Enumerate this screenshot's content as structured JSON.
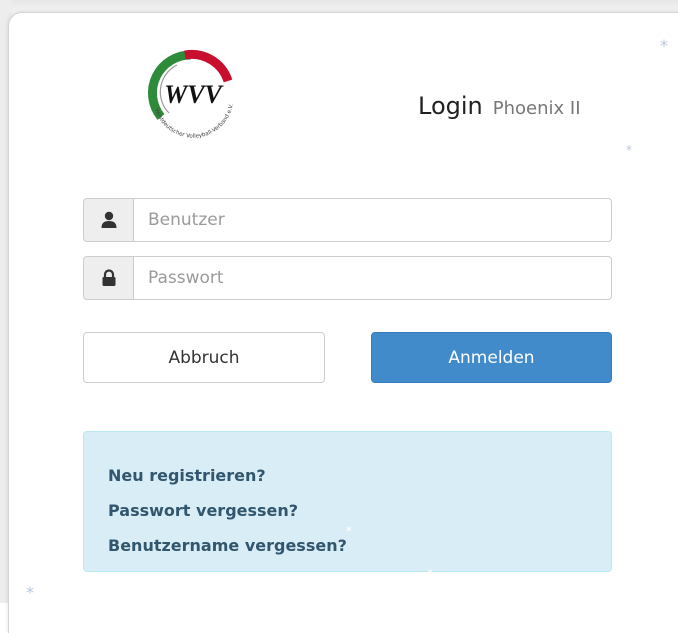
{
  "header": {
    "logo_text": "WVV",
    "logo_ring_text": "Westdeutscher Volleyball-Verband e.V.",
    "title": "Login",
    "subtitle": "Phoenix II"
  },
  "form": {
    "username_placeholder": "Benutzer",
    "password_placeholder": "Passwort",
    "user_icon": "user-icon",
    "lock_icon": "lock-icon"
  },
  "buttons": {
    "cancel_label": "Abbruch",
    "login_label": "Anmelden"
  },
  "links": {
    "register": "Neu registrieren?",
    "forgot_password": "Passwort vergessen?",
    "forgot_username": "Benutzername vergessen?"
  },
  "colors": {
    "primary": "#428bca",
    "info_bg": "#d9edf7",
    "logo_red": "#c8102e",
    "logo_green": "#2e8b3a"
  }
}
